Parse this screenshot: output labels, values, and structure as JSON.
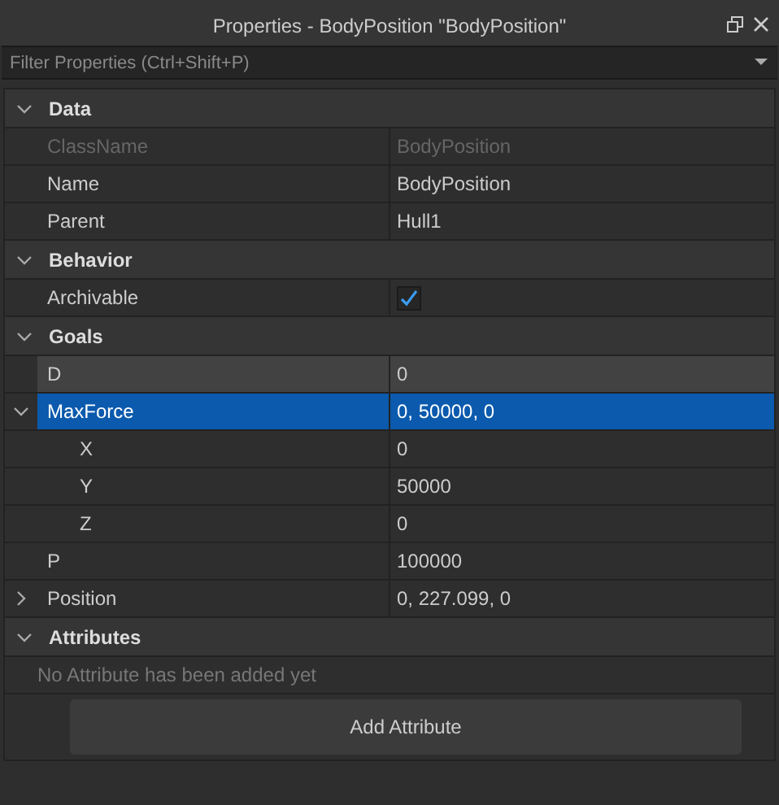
{
  "window": {
    "title": "Properties - BodyPosition \"BodyPosition\""
  },
  "filter": {
    "placeholder": "Filter Properties (Ctrl+Shift+P)"
  },
  "sections": [
    {
      "name": "Data",
      "expanded": true,
      "properties": [
        {
          "kind": "text",
          "label": "ClassName",
          "value": "BodyPosition",
          "disabled": true,
          "selected": false,
          "hovered": false
        },
        {
          "kind": "text",
          "label": "Name",
          "value": "BodyPosition",
          "disabled": false,
          "selected": false,
          "hovered": false
        },
        {
          "kind": "text",
          "label": "Parent",
          "value": "Hull1",
          "disabled": false,
          "selected": false,
          "hovered": false
        }
      ]
    },
    {
      "name": "Behavior",
      "expanded": true,
      "properties": [
        {
          "kind": "checkbox",
          "label": "Archivable",
          "checked": true,
          "disabled": false,
          "selected": false,
          "hovered": false
        }
      ]
    },
    {
      "name": "Goals",
      "expanded": true,
      "properties": [
        {
          "kind": "text",
          "label": "D",
          "value": "0",
          "disabled": false,
          "selected": false,
          "hovered": true
        },
        {
          "kind": "text",
          "label": "MaxForce",
          "value": "0, 50000, 0",
          "disabled": false,
          "selected": true,
          "hovered": false,
          "expanded": true,
          "children": [
            {
              "kind": "text",
              "label": "X",
              "value": "0",
              "disabled": false,
              "selected": false,
              "hovered": false
            },
            {
              "kind": "text",
              "label": "Y",
              "value": "50000",
              "disabled": false,
              "selected": false,
              "hovered": false
            },
            {
              "kind": "text",
              "label": "Z",
              "value": "0",
              "disabled": false,
              "selected": false,
              "hovered": false
            }
          ]
        },
        {
          "kind": "text",
          "label": "P",
          "value": "100000",
          "disabled": false,
          "selected": false,
          "hovered": false
        },
        {
          "kind": "text",
          "label": "Position",
          "value": "0, 227.099, 0",
          "disabled": false,
          "selected": false,
          "hovered": false,
          "expanded": false
        }
      ]
    },
    {
      "name": "Attributes",
      "expanded": true,
      "empty_text": "No Attribute has been added yet",
      "add_button": "Add Attribute"
    }
  ]
}
